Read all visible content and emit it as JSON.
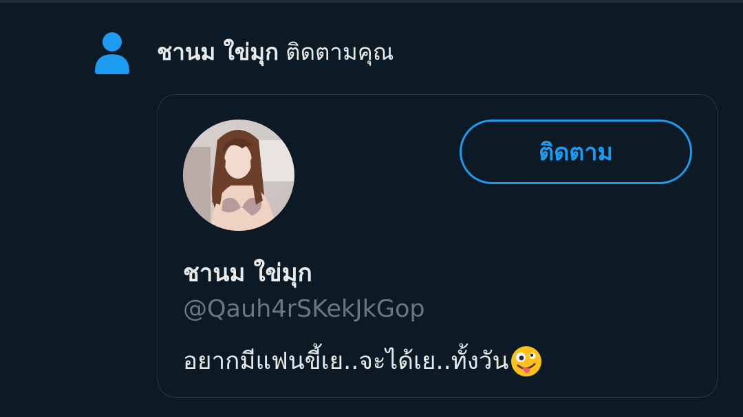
{
  "notification": {
    "icon": "person-icon",
    "name": "ชานม ใข่มุก",
    "action": "ติดตามคุณ"
  },
  "profile_card": {
    "avatar_alt": "profile-photo",
    "follow_label": "ติดตาม",
    "display_name": "ชานม ใข่มุก",
    "handle": "@Qauh4rSKekJkGop",
    "bio": "อยากมีแฟนขี้เย..จะได้เย..ทั้งวัน",
    "bio_emoji": "zany-face-emoji"
  },
  "colors": {
    "background": "#0b1a24",
    "accent": "#1d9bf0",
    "text_primary": "#e7e9ea",
    "text_secondary": "#6e767d",
    "card_border": "#2a3a46"
  }
}
